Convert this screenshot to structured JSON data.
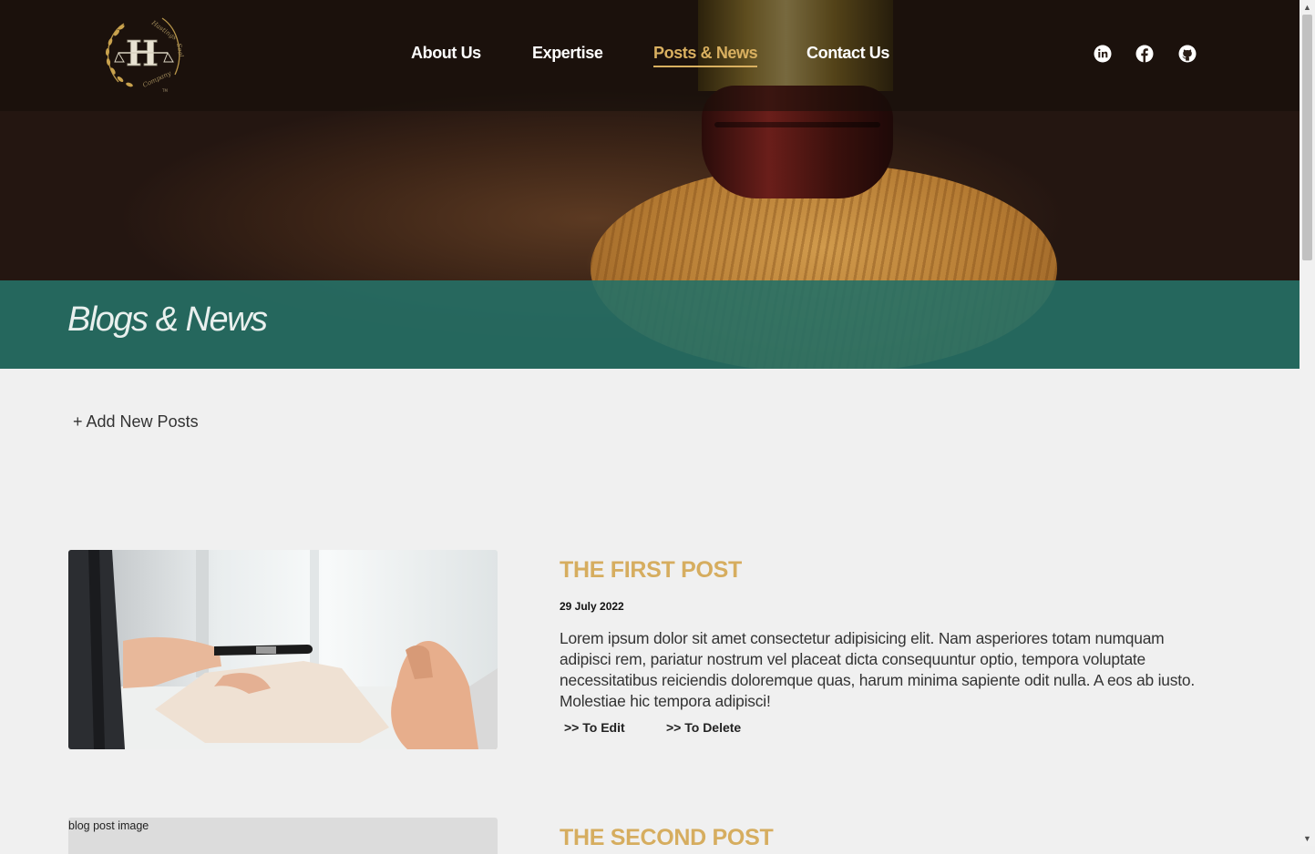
{
  "nav": {
    "logo_alt": "Hastings Seal",
    "links": [
      {
        "label": "About Us",
        "active": false
      },
      {
        "label": "Expertise",
        "active": false
      },
      {
        "label": "Posts & News",
        "active": true
      },
      {
        "label": "Contact Us",
        "active": false
      }
    ],
    "social_icons": [
      "linkedin-icon",
      "facebook-icon",
      "github-icon"
    ]
  },
  "hero": {
    "heading": "Blogs & News"
  },
  "actions": {
    "add_post": "+ Add New Posts"
  },
  "posts": [
    {
      "title": "THE FIRST POST",
      "date": "29 July 2022",
      "excerpt": "Lorem ipsum dolor sit amet consectetur adipisicing elit. Nam asperiores totam numquam adipisci rem, pariatur nostrum vel placeat dicta consequuntur optio, tempora voluptate necessitatibus reiciendis doloremque quas, harum minima sapiente odit nulla. A eos ab iusto. Molestiae hic tempora adipisci!",
      "edit_label": ">> To Edit",
      "delete_label": ">> To Delete"
    },
    {
      "title": "THE SECOND POST",
      "image_alt": "blog post image"
    }
  ],
  "colors": {
    "accent_gold": "#d6ad5f",
    "teal_band": "#267066",
    "page_bg": "#f0f0f0"
  }
}
